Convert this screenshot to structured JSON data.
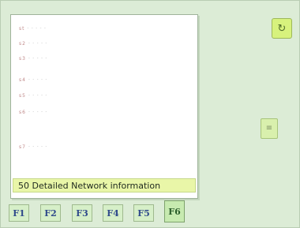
{
  "panel": {
    "list_items": [
      {
        "mark": "st",
        "text": "- - - - -"
      },
      {
        "mark": "s2",
        "text": "- - - - -"
      },
      {
        "mark": "s3",
        "text": "- - - - -"
      },
      {
        "mark": "s4",
        "text": "- - - - -"
      },
      {
        "mark": "s5",
        "text": "- - - - -"
      },
      {
        "mark": "s6",
        "text": "- - - - -"
      },
      {
        "mark": "s7",
        "text": "- - - - -"
      }
    ],
    "caption": "50 Detailed Network information"
  },
  "side_buttons": {
    "top_icon": "cycle-icon",
    "top_glyph": "↻",
    "mid_icon": "menu-icon",
    "mid_glyph": "≡"
  },
  "function_keys": [
    "F1",
    "F2",
    "F3",
    "F4",
    "F5",
    "F6"
  ],
  "selected_function_key": "F6"
}
